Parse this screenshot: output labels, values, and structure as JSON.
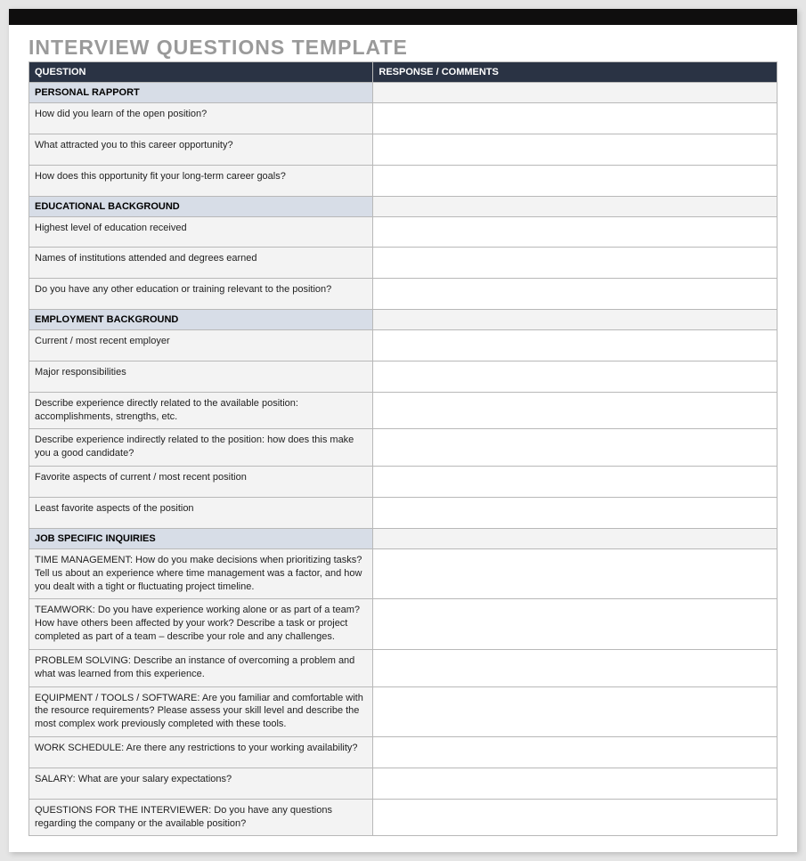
{
  "title": "INTERVIEW QUESTIONS TEMPLATE",
  "headers": {
    "question": "QUESTION",
    "response": "RESPONSE / COMMENTS"
  },
  "sections": [
    {
      "name": "PERSONAL RAPPORT",
      "questions": [
        "How did you learn of the open position?",
        "What attracted you to this career opportunity?",
        "How does this opportunity fit your long-term career goals?"
      ]
    },
    {
      "name": "EDUCATIONAL BACKGROUND",
      "questions": [
        "Highest level of education received",
        "Names of institutions attended and degrees earned",
        "Do you have any other education or training relevant to the position?"
      ]
    },
    {
      "name": "EMPLOYMENT BACKGROUND",
      "questions": [
        "Current / most recent employer",
        "Major responsibilities",
        "Describe experience directly related to the available position: accomplishments, strengths, etc.",
        "Describe experience indirectly related to the position: how does this make you a good candidate?",
        "Favorite aspects of current / most recent position",
        "Least favorite aspects of the position"
      ]
    },
    {
      "name": "JOB SPECIFIC INQUIRIES",
      "questions": [
        "TIME MANAGEMENT: How do you make decisions when prioritizing tasks? Tell us about an experience where time management was a factor, and how you dealt with a tight or fluctuating project timeline.",
        "TEAMWORK: Do you have experience working alone or as part of a team? How have others been affected by your work? Describe a task or project completed as part of a team – describe your role and any challenges.",
        "PROBLEM SOLVING: Describe an instance of overcoming a problem and what was learned from this experience.",
        "EQUIPMENT / TOOLS / SOFTWARE: Are you familiar and comfortable with the resource requirements? Please assess your skill level and describe the most complex work previously completed with these tools.",
        "WORK SCHEDULE: Are there any restrictions to your working availability?",
        "SALARY: What are your salary expectations?",
        "QUESTIONS FOR THE INTERVIEWER: Do you have any questions regarding the company or the available position?"
      ]
    }
  ]
}
